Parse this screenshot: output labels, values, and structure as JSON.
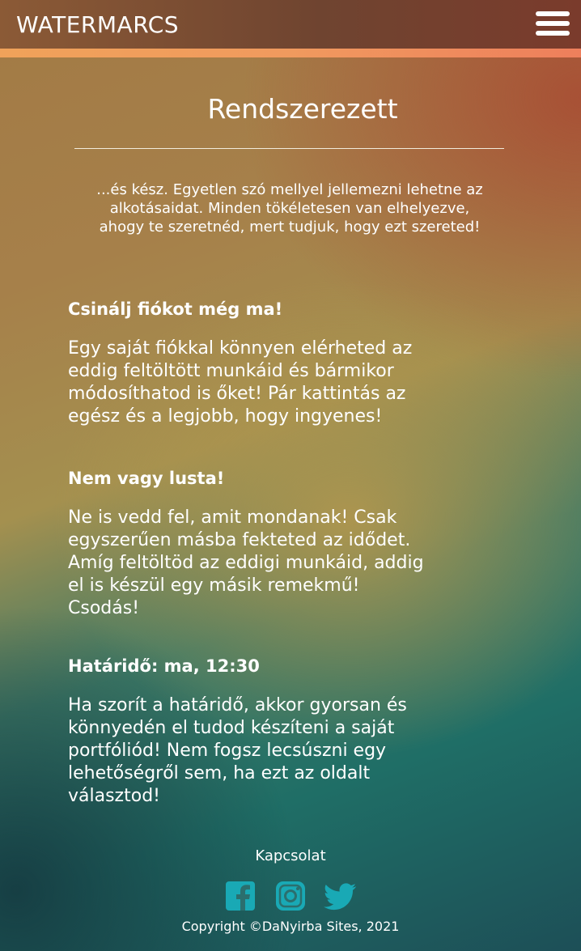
{
  "header": {
    "logo": "WATERMARCS",
    "menu_icon": "hamburger-menu-icon"
  },
  "hero": {
    "title": "Rendszerezett",
    "text": "...és kész. Egyetlen szó mellyel jellemezni lehetne az alkotásaidat. Minden tökéletesen van elhelyezve, ahogy te szeretnéd, mert tudjuk, hogy ezt szereted!"
  },
  "sections": [
    {
      "title": "Csinálj fiókot még ma!",
      "text": "Egy saját fiókkal könnyen elérheted az eddig feltöltött munkáid és bármikor módosíthatod is őket! Pár kattintás az egész és a legjobb, hogy ingyenes!"
    },
    {
      "title": "Nem vagy lusta!",
      "text": "Ne is vedd fel, amit mondanak! Csak egyszerűen másba fekteted az idődet. Amíg feltöltöd az eddigi munkáid, addig el is készül egy másik remekmű! Csodás!"
    },
    {
      "title": "Határidő: ma, 12:30",
      "text": "Ha szorít a határidő, akkor gyorsan és könnyedén el tudod készíteni a saját portfóliód! Nem fogsz lecsúszni egy lehetőségről sem, ha ezt az oldalt választod!"
    }
  ],
  "footer": {
    "contact": "Kapcsolat",
    "social": [
      "facebook-icon",
      "instagram-icon",
      "twitter-icon"
    ],
    "copyright": "Copyright ©DaNyirba Sites, 2021"
  },
  "colors": {
    "accent": "#ef9a5c",
    "social_icon": "#19a9b5",
    "header": "#6f4430"
  }
}
